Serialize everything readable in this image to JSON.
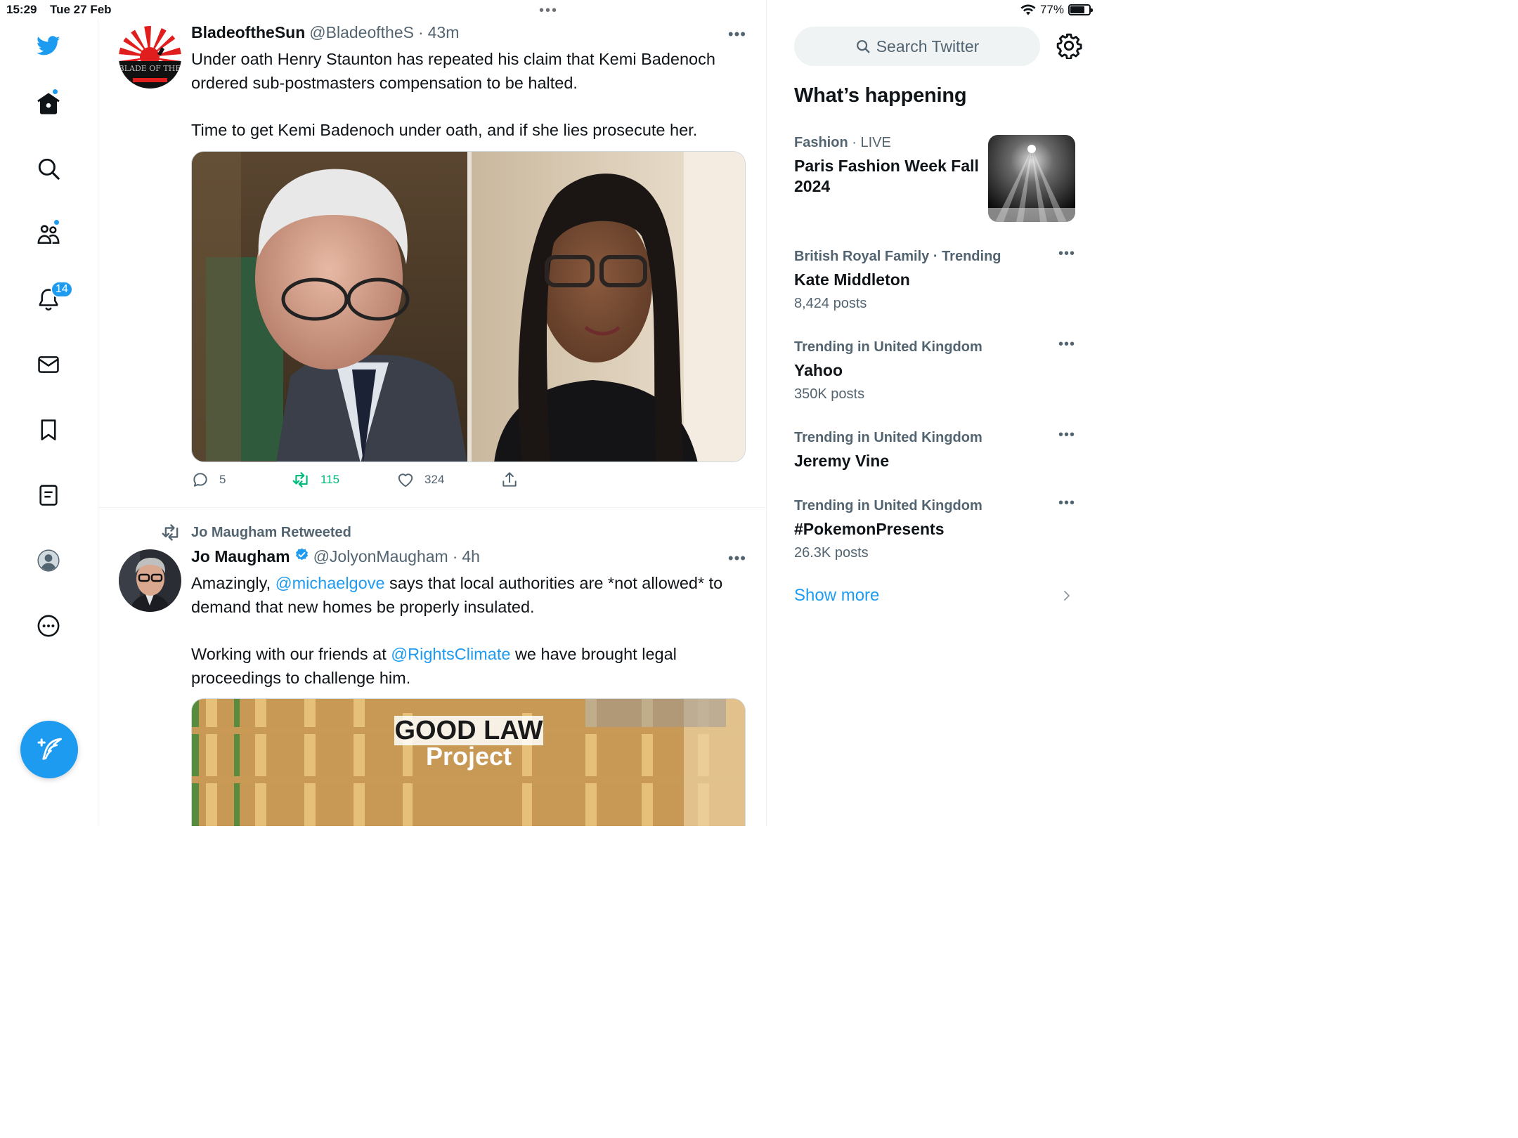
{
  "status_bar": {
    "time": "15:29",
    "date": "Tue 27 Feb",
    "battery": "77%",
    "battery_level": 0.77
  },
  "nav": {
    "items": [
      "twitter-logo",
      "home",
      "explore",
      "communities",
      "notifications",
      "messages",
      "bookmarks",
      "lists",
      "profile",
      "more"
    ],
    "notifications_badge": "14"
  },
  "tweets": [
    {
      "author_name": "BladeoftheSun",
      "handle": "@BladeoftheS",
      "separator": "·",
      "time": "43m",
      "avatar_text": "BLADE OF THE",
      "text_p1": "Under oath Henry Staunton has repeated his claim that Kemi Badenoch ordered sub-postmasters compensation to be halted.",
      "text_p2": "Time to get Kemi Badenoch under oath, and if she lies prosecute her.",
      "replies": "5",
      "retweets": "115",
      "likes": "324"
    },
    {
      "retweeted_by": "Jo Maugham Retweeted",
      "author_name": "Jo Maugham",
      "handle": "@JolyonMaugham",
      "separator": "·",
      "time": "4h",
      "text_p1_a": "Amazingly, ",
      "text_p1_mention": "@michaelgove",
      "text_p1_b": " says that local authorities are *not allowed* to demand that new homes be properly insulated.",
      "text_p2_a": "Working with our friends at ",
      "text_p2_mention": "@RightsClimate",
      "text_p2_b": " we have brought legal proceedings to challenge him.",
      "media_caption_1": "GOOD LAW",
      "media_caption_2": "Project"
    }
  ],
  "sidebar": {
    "search_placeholder": "Search Twitter",
    "title": "What’s happening",
    "trends": [
      {
        "category": "Fashion",
        "meta_suffix": "LIVE",
        "name": "Paris Fashion Week Fall 2024",
        "count": ""
      },
      {
        "category": "British Royal Family",
        "meta_suffix": "Trending",
        "name": "Kate Middleton",
        "count": "8,424 posts"
      },
      {
        "category": "Trending in United Kingdom",
        "meta_suffix": "",
        "name": "Yahoo",
        "count": "350K posts"
      },
      {
        "category": "Trending in United Kingdom",
        "meta_suffix": "",
        "name": "Jeremy Vine",
        "count": ""
      },
      {
        "category": "Trending in United Kingdom",
        "meta_suffix": "",
        "name": "#PokemonPresents",
        "count": "26.3K posts"
      }
    ],
    "show_more": "Show more"
  },
  "colors": {
    "accent": "#1d9bf0",
    "retweet_green": "#00ba7c",
    "secondary_text": "#536471",
    "border": "#eff3f4"
  }
}
